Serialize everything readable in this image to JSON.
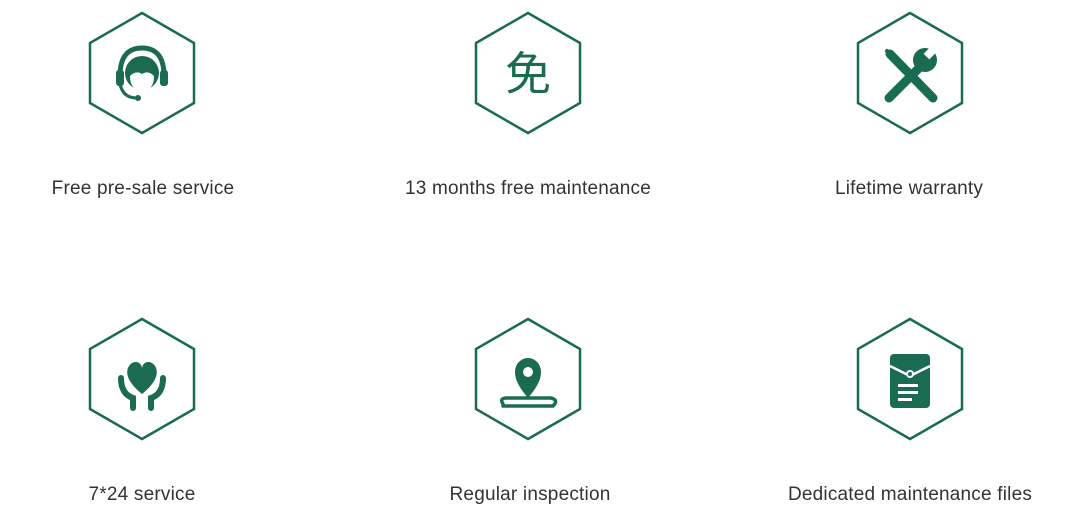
{
  "colors": {
    "accent": "#1a6b52",
    "text": "#333333",
    "background": "#ffffff"
  },
  "features": [
    {
      "label": "Free pre-sale service",
      "icon": "headset-support-icon"
    },
    {
      "label": "13 months free maintenance",
      "icon": "free-character-icon",
      "glyph": "免"
    },
    {
      "label": "Lifetime warranty",
      "icon": "wrench-screwdriver-icon"
    },
    {
      "label": "7*24 service",
      "icon": "heart-hands-icon"
    },
    {
      "label": "Regular inspection",
      "icon": "location-pin-route-icon"
    },
    {
      "label": "Dedicated maintenance files",
      "icon": "file-folder-icon"
    }
  ]
}
